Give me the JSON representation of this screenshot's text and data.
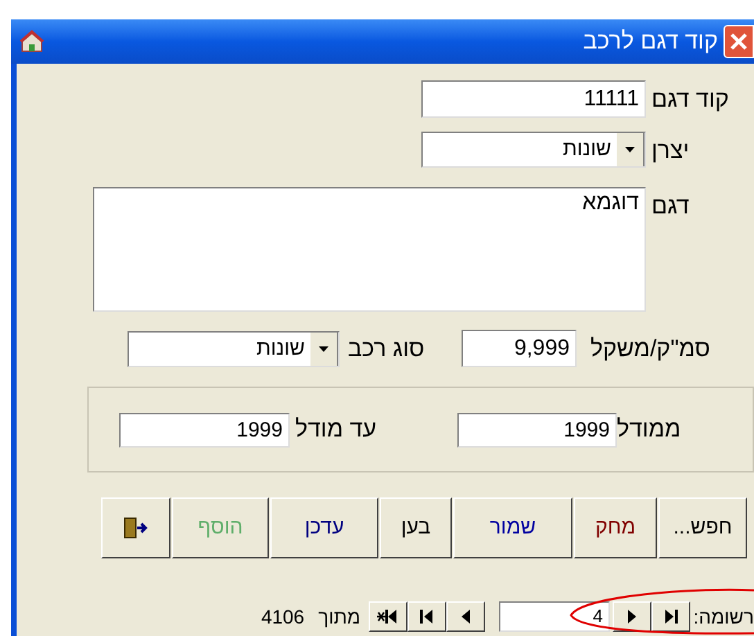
{
  "window": {
    "title": "קוד דגם לרכב"
  },
  "fields": [
    {
      "kind": "text",
      "label": "קוד דגם",
      "value": "11111"
    },
    {
      "kind": "combo",
      "label": "יצרן",
      "value": "שונות"
    },
    {
      "kind": "memo",
      "label": "דגם",
      "value": "דוגמא"
    }
  ],
  "weight": {
    "label": "סמ\"ק/משקל",
    "value": "9,999"
  },
  "vehicle_type": {
    "label": "סוג רכב",
    "value": "שונות"
  },
  "range": {
    "from_label": "ממודל",
    "from_value": "1999",
    "to_label": "עד מודל",
    "to_value": "1999"
  },
  "buttons": [
    {
      "kind": "text",
      "label": "חפש...",
      "color": "#000000"
    },
    {
      "kind": "text",
      "label": "מחק",
      "color": "#800000"
    },
    {
      "kind": "text",
      "label": "שמור",
      "color": "#0000a0"
    },
    {
      "kind": "text",
      "label": "בען",
      "color": "#000000"
    },
    {
      "kind": "text",
      "label": "עדכן",
      "color": "#000080"
    },
    {
      "kind": "text",
      "label": "הוסף",
      "color": "#5fae6a"
    },
    {
      "kind": "exit"
    }
  ],
  "navigator": {
    "label": "רשומה:",
    "current": "4",
    "of_label": "מתוך",
    "total": "4106"
  }
}
